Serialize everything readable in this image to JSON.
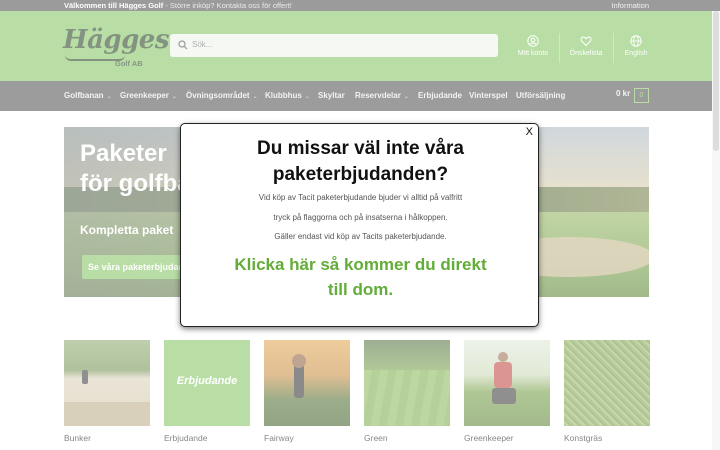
{
  "topbar": {
    "brand": "Välkommen till Hägges Golf",
    "message": " - Större inköp? Kontakta oss för offert!",
    "info": "Information"
  },
  "header": {
    "logo_text": "Hägges",
    "logo_sub": "Golf AB",
    "search_placeholder": "Sök...",
    "actions": [
      {
        "label": "Mitt konto",
        "icon": "user-icon"
      },
      {
        "label": "Önskelista",
        "icon": "heart-icon"
      },
      {
        "label": "English",
        "icon": "globe-icon"
      }
    ]
  },
  "nav": {
    "items": [
      {
        "label": "Golfbanan",
        "dropdown": true
      },
      {
        "label": "Greenkeeper",
        "dropdown": true
      },
      {
        "label": "Övningsområdet",
        "dropdown": true
      },
      {
        "label": "Klubbhus",
        "dropdown": true
      },
      {
        "label": "Skyltar",
        "dropdown": false
      },
      {
        "label": "Reservdelar",
        "dropdown": true
      },
      {
        "label": "Erbjudande",
        "dropdown": false
      },
      {
        "label": "Vinterspel",
        "dropdown": false
      },
      {
        "label": "Utförsäljning",
        "dropdown": false
      }
    ],
    "cart_total": "0 kr",
    "cart_count": "0"
  },
  "hero": {
    "headline_line1": "Paketer",
    "headline_line2": "för golfba",
    "subheadline": "Kompletta paket",
    "button": "Se våra paketerbjudanden"
  },
  "categories": [
    {
      "label": "Bunker"
    },
    {
      "label": "Erbjudande",
      "thumb_text": "Erbjudande"
    },
    {
      "label": "Fairway"
    },
    {
      "label": "Green"
    },
    {
      "label": "Greenkeeper"
    },
    {
      "label": "Konstgräs"
    }
  ],
  "modal": {
    "title_line1": "Du missar väl inte våra",
    "title_line2": "paketerbjudanden?",
    "body_line1": "Vid köp av Tacit paketerbjudande bjuder vi alltid på valfritt",
    "body_line2": "tryck på flaggorna och på insatserna i hålkoppen.",
    "body_line3": "Gäller endast vid köp av Tacits paketerbjudande.",
    "cta_line1": "Klicka här så kommer du direkt",
    "cta_line2": "till dom.",
    "close": "X"
  },
  "colors": {
    "brand_green": "#7fc35b",
    "cta_green": "#62ad38",
    "nav_dark": "#4c4c4c"
  }
}
